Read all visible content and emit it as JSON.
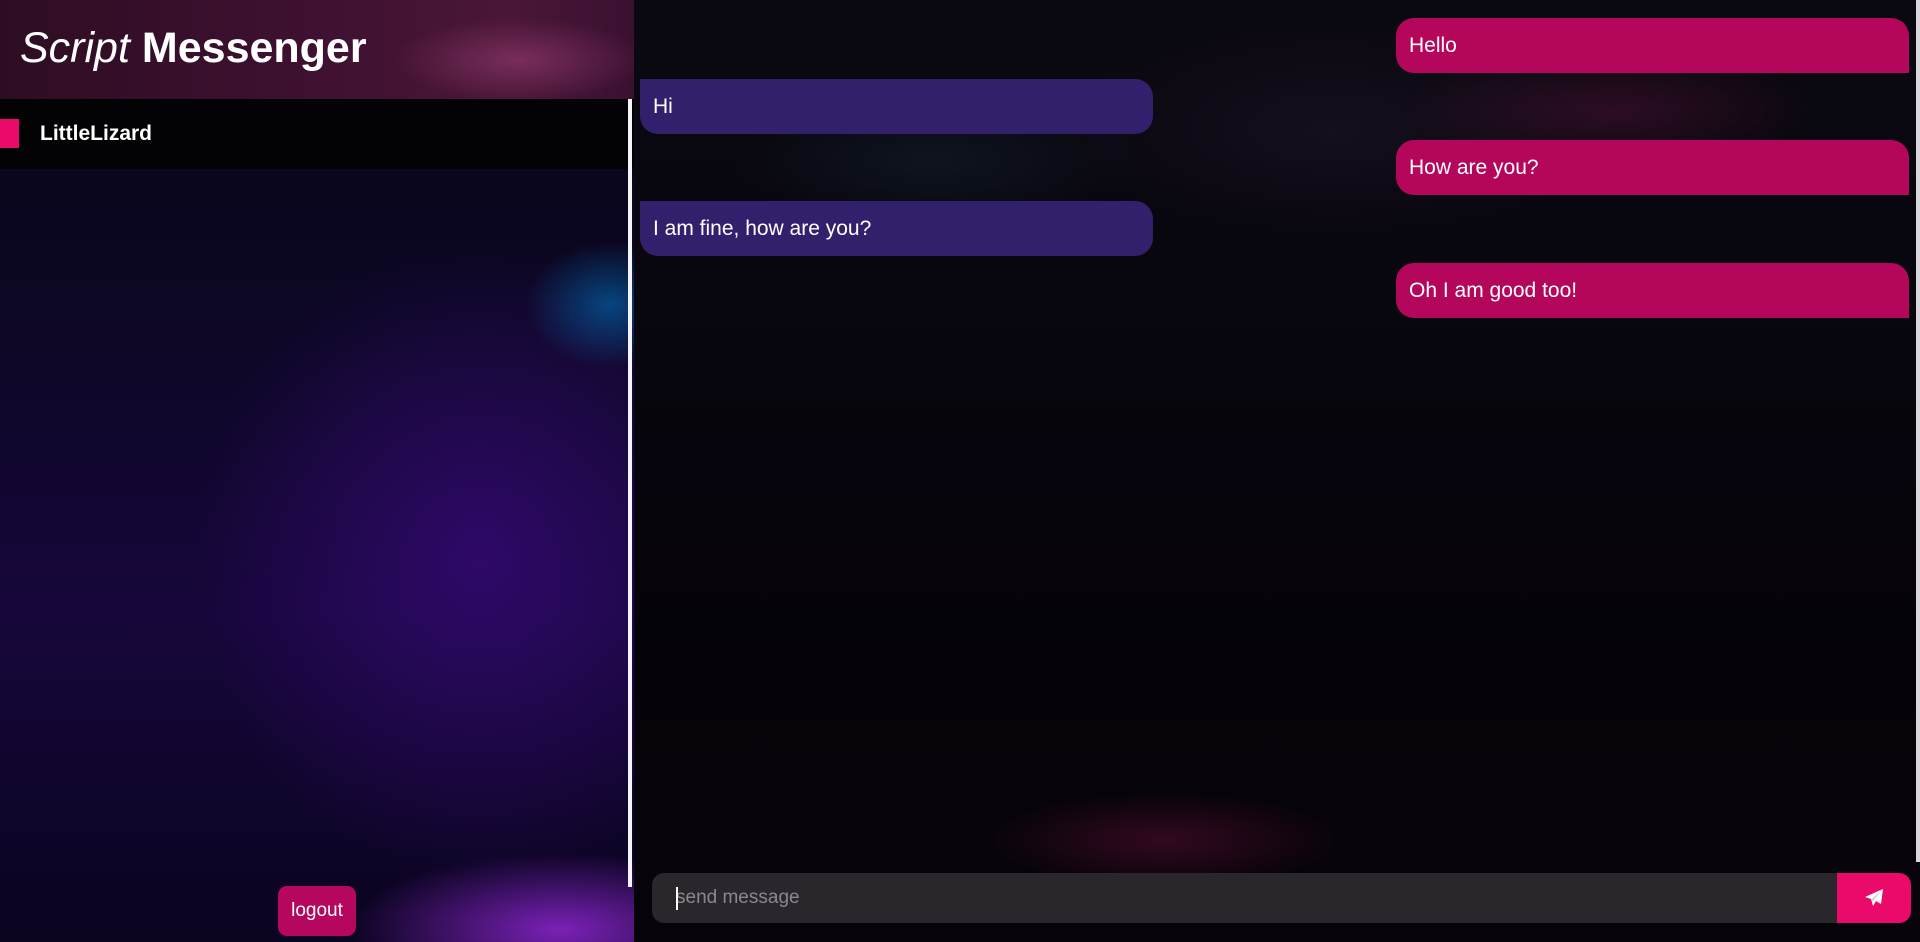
{
  "app": {
    "title_part1": "Script",
    "title_part2": "Messenger"
  },
  "sidebar": {
    "contacts": [
      {
        "name": "LittleLizard",
        "active": true
      }
    ],
    "logout_label": "logout"
  },
  "chat": {
    "messages": [
      {
        "direction": "sent",
        "text": "Hello"
      },
      {
        "direction": "received",
        "text": "Hi"
      },
      {
        "direction": "sent",
        "text": "How are you?"
      },
      {
        "direction": "received",
        "text": "I am fine, how are you?"
      },
      {
        "direction": "sent",
        "text": "Oh I am good too!"
      }
    ],
    "composer": {
      "placeholder": "send message",
      "value": ""
    },
    "send_icon": "paper-plane-icon"
  },
  "colors": {
    "accent": "#ea0a6a",
    "sent_bubble": "#b4075c",
    "received_bubble": "#33206c",
    "logout_button": "#b5075d",
    "composer_bg": "#29262c"
  }
}
